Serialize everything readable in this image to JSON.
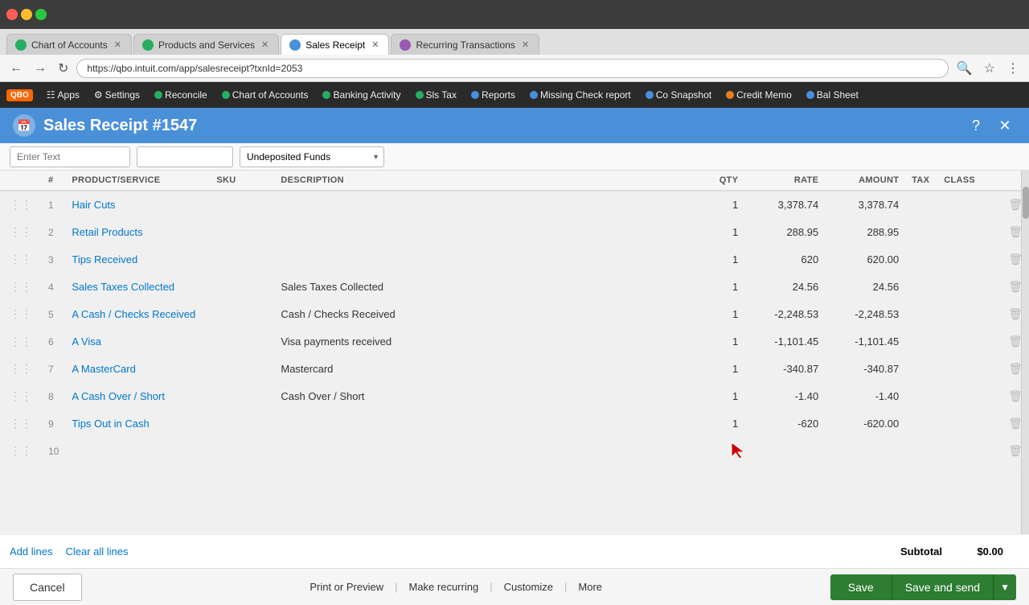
{
  "browser": {
    "url": "https://qbo.intuit.com/app/salesreceipt?txnId=2053",
    "tabs": [
      {
        "label": "Chart of Accounts",
        "active": false,
        "color": "#27ae60"
      },
      {
        "label": "Products and Services",
        "active": false,
        "color": "#27ae60"
      },
      {
        "label": "Sales Receipt",
        "active": true,
        "color": "#4a90d9"
      },
      {
        "label": "Recurring Transactions",
        "active": false,
        "color": "#9b59b6"
      }
    ]
  },
  "nav": {
    "logo": "QBO",
    "items": [
      {
        "label": "Apps",
        "icon": "grid"
      },
      {
        "label": "Settings",
        "icon": "gear",
        "color": "#888"
      },
      {
        "label": "Reconcile",
        "icon": "dot",
        "color": "#27ae60"
      },
      {
        "label": "Chart of Accounts",
        "icon": "dot",
        "color": "#27ae60"
      },
      {
        "label": "Banking Activity",
        "icon": "dot",
        "color": "#27ae60"
      },
      {
        "label": "Sls Tax",
        "icon": "dot",
        "color": "#27ae60"
      },
      {
        "label": "Reports",
        "icon": "dot",
        "color": "#4a90d9"
      },
      {
        "label": "Missing Check report",
        "icon": "dot",
        "color": "#4a90d9"
      },
      {
        "label": "Co Snapshot",
        "icon": "dot",
        "color": "#4a90d9"
      },
      {
        "label": "Credit Memo",
        "icon": "dot",
        "color": "#e67e22"
      },
      {
        "label": "Bal Sheet",
        "icon": "dot",
        "color": "#4a90d9"
      }
    ]
  },
  "page": {
    "title": "Sales Receipt  #1547",
    "deposit_placeholder": "Enter Text",
    "deposit_account": "Undeposited Funds"
  },
  "table": {
    "columns": [
      "",
      "#",
      "PRODUCT/SERVICE",
      "SKU",
      "DESCRIPTION",
      "QTY",
      "RATE",
      "AMOUNT",
      "TAX",
      "CLASS",
      ""
    ],
    "rows": [
      {
        "num": "1",
        "product": "Hair Cuts",
        "sku": "",
        "description": "",
        "qty": "1",
        "rate": "3,378.74",
        "amount": "3,378.74",
        "tax": "",
        "class": ""
      },
      {
        "num": "2",
        "product": "Retail Products",
        "sku": "",
        "description": "",
        "qty": "1",
        "rate": "288.95",
        "amount": "288.95",
        "tax": "",
        "class": ""
      },
      {
        "num": "3",
        "product": "Tips Received",
        "sku": "",
        "description": "",
        "qty": "1",
        "rate": "620",
        "amount": "620.00",
        "tax": "",
        "class": ""
      },
      {
        "num": "4",
        "product": "Sales Taxes Collected",
        "sku": "",
        "description": "Sales Taxes Collected",
        "qty": "1",
        "rate": "24.56",
        "amount": "24.56",
        "tax": "",
        "class": ""
      },
      {
        "num": "5",
        "product": "A Cash / Checks Received",
        "sku": "",
        "description": "Cash / Checks Received",
        "qty": "1",
        "rate": "-2,248.53",
        "amount": "-2,248.53",
        "tax": "",
        "class": ""
      },
      {
        "num": "6",
        "product": "A Visa",
        "sku": "",
        "description": "Visa payments received",
        "qty": "1",
        "rate": "-1,101.45",
        "amount": "-1,101.45",
        "tax": "",
        "class": ""
      },
      {
        "num": "7",
        "product": "A MasterCard",
        "sku": "",
        "description": "Mastercard",
        "qty": "1",
        "rate": "-340.87",
        "amount": "-340.87",
        "tax": "",
        "class": ""
      },
      {
        "num": "8",
        "product": "A Cash Over / Short",
        "sku": "",
        "description": "Cash Over / Short",
        "qty": "1",
        "rate": "-1.40",
        "amount": "-1.40",
        "tax": "",
        "class": ""
      },
      {
        "num": "9",
        "product": "Tips Out in Cash",
        "sku": "",
        "description": "",
        "qty": "1",
        "rate": "-620",
        "amount": "-620.00",
        "tax": "",
        "class": ""
      },
      {
        "num": "10",
        "product": "",
        "sku": "",
        "description": "",
        "qty": "",
        "rate": "",
        "amount": "",
        "tax": "",
        "class": ""
      }
    ]
  },
  "actions": {
    "add_lines": "Add lines",
    "clear_all": "Clear all lines",
    "subtotal_label": "Subtotal",
    "subtotal_value": "$0.00"
  },
  "footer": {
    "cancel": "Cancel",
    "print": "Print or Preview",
    "recurring": "Make recurring",
    "customize": "Customize",
    "more": "More",
    "save": "Save",
    "save_and_send": "Save and send"
  }
}
